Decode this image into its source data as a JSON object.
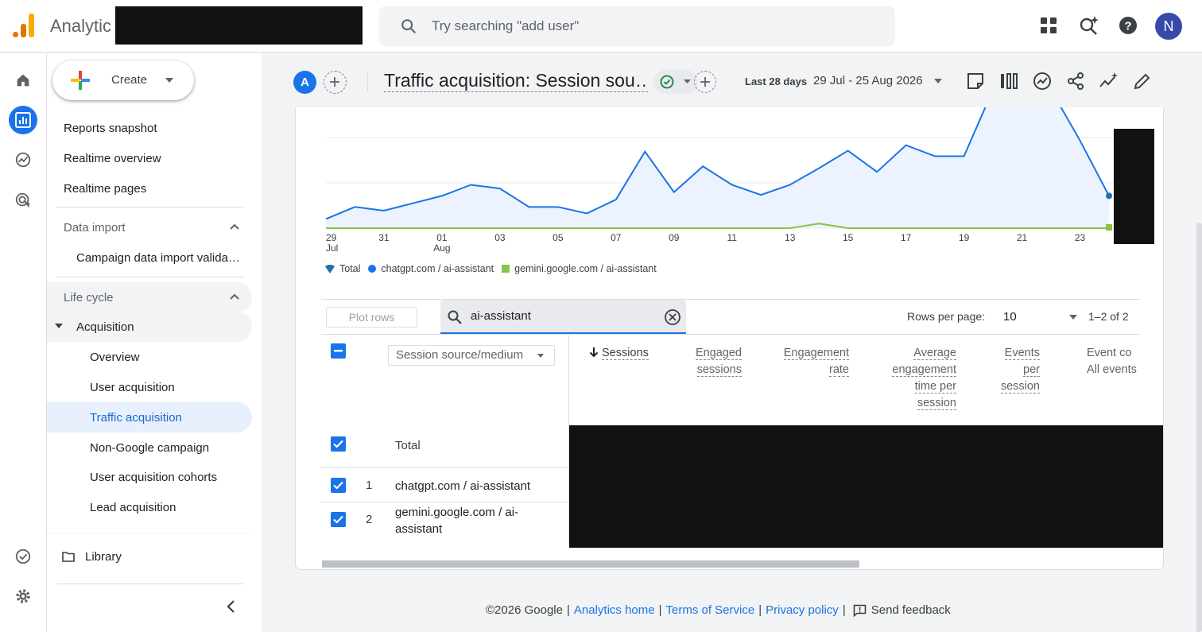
{
  "app": {
    "name": "Analytic",
    "search_placeholder": "Try searching \"add user\"",
    "avatar_letter": "N",
    "create_label": "Create"
  },
  "sidebar": {
    "items": [
      {
        "label": "Reports snapshot"
      },
      {
        "label": "Realtime overview"
      },
      {
        "label": "Realtime pages"
      },
      {
        "label": "Data import"
      },
      {
        "label": "Campaign data import valida…"
      },
      {
        "label": "Life cycle"
      },
      {
        "label": "Acquisition"
      },
      {
        "label": "Overview"
      },
      {
        "label": "User acquisition"
      },
      {
        "label": "Traffic acquisition"
      },
      {
        "label": "Non-Google campaign"
      },
      {
        "label": "User acquisition cohorts"
      },
      {
        "label": "Lead acquisition"
      }
    ],
    "library_label": "Library"
  },
  "header": {
    "comparison_letter": "A",
    "report_title": "Traffic acquisition: Session sou…",
    "date_preset": "Last 28 days",
    "date_range": "29 Jul - 25 Aug 2026"
  },
  "chart_data": {
    "type": "line",
    "x": [
      "29 Jul",
      "30",
      "31",
      "01 Aug",
      "02",
      "03",
      "04",
      "05",
      "06",
      "07",
      "08",
      "09",
      "10",
      "11",
      "12",
      "13",
      "14",
      "15",
      "16",
      "17",
      "18",
      "19",
      "20",
      "21",
      "22",
      "23",
      "24",
      "25"
    ],
    "xtick_labels": [
      "29",
      "31",
      "01",
      "03",
      "05",
      "07",
      "09",
      "11",
      "13",
      "15",
      "17",
      "19",
      "21",
      "23",
      "25"
    ],
    "xtick_sublabels": {
      "29": "Jul",
      "01": "Aug"
    },
    "series": [
      {
        "name": "chatgpt.com / ai-assistant",
        "color": "#1a73e8",
        "values": [
          10,
          23,
          19,
          27,
          35,
          47,
          43,
          23,
          23,
          16,
          31,
          83,
          39,
          67,
          47,
          36,
          47,
          65,
          84,
          61,
          90,
          78,
          78,
          150,
          150,
          150,
          95,
          35
        ]
      },
      {
        "name": "gemini.google.com / ai-assistant",
        "color": "#8bc34a",
        "values": [
          0,
          0,
          0,
          0,
          0,
          0,
          0,
          0,
          0,
          0,
          0,
          0,
          0,
          0,
          0,
          0,
          0,
          5,
          0,
          0,
          0,
          0,
          0,
          0,
          0,
          0,
          0,
          0
        ]
      }
    ],
    "legend_total": "Total",
    "grid": true,
    "legend_position": "bottom-left"
  },
  "table": {
    "plot_rows_label": "Plot rows",
    "filter_value": "ai-assistant",
    "rows_per_page_label": "Rows per page:",
    "rows_per_page": "10",
    "pagination": "1–2 of 2",
    "dimension_label": "Session source/medium",
    "columns": [
      "Sessions",
      "Engaged sessions",
      "Engagement rate",
      "Average engagement time per session",
      "Events per session",
      "Event co"
    ],
    "event_count_sub": "All events",
    "total_label": "Total",
    "rows": [
      {
        "num": "1",
        "dim": "chatgpt.com / ai-assistant"
      },
      {
        "num": "2",
        "dim": "gemini.google.com / ai-assistant"
      }
    ]
  },
  "footer": {
    "copyright": "©2026 Google",
    "links": [
      "Analytics home",
      "Terms of Service",
      "Privacy policy"
    ],
    "feedback": "Send feedback"
  }
}
